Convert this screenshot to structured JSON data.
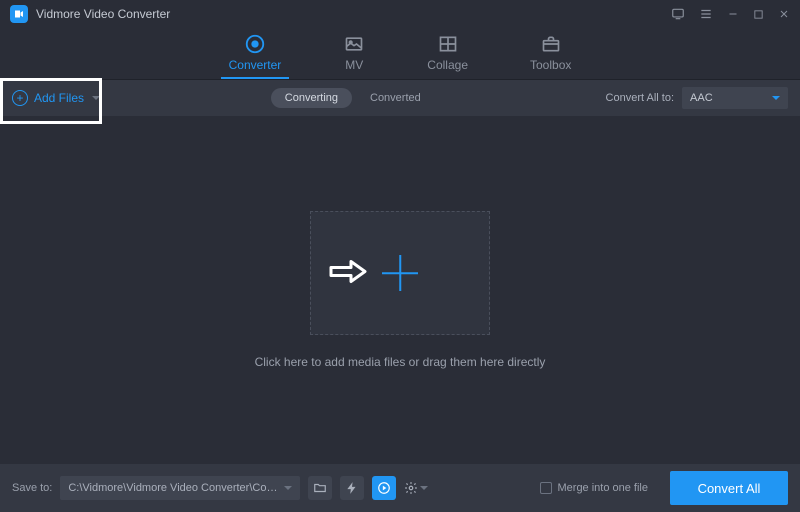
{
  "app": {
    "title": "Vidmore Video Converter"
  },
  "tabs": {
    "converter": "Converter",
    "mv": "MV",
    "collage": "Collage",
    "toolbox": "Toolbox"
  },
  "toolbar": {
    "add_files": "Add Files",
    "converting": "Converting",
    "converted": "Converted",
    "convert_all_to": "Convert All to:",
    "selected_format": "AAC"
  },
  "main": {
    "drop_hint": "Click here to add media files or drag them here directly"
  },
  "footer": {
    "save_to_label": "Save to:",
    "save_path": "C:\\Vidmore\\Vidmore Video Converter\\Converted",
    "merge_label": "Merge into one file",
    "convert_all": "Convert All"
  }
}
